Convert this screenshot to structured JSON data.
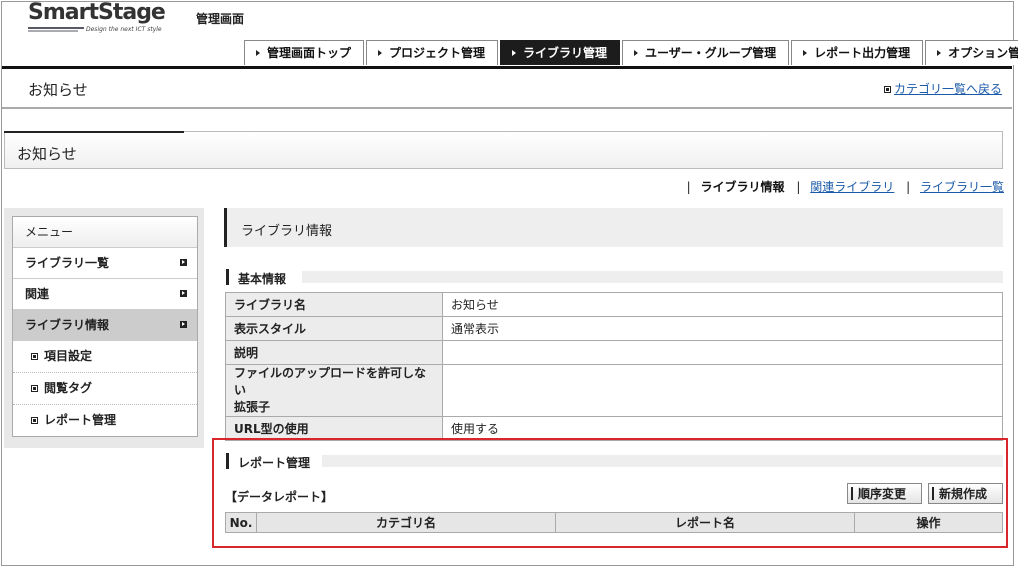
{
  "header": {
    "logo_text": "SmartStage",
    "logo_tagline": "Design the next ICT style",
    "admin_title": "管理画面"
  },
  "nav": {
    "items": [
      {
        "label": "管理画面トップ",
        "active": false
      },
      {
        "label": "プロジェクト管理",
        "active": false
      },
      {
        "label": "ライブラリ管理",
        "active": true
      },
      {
        "label": "ユーザー・グループ管理",
        "active": false
      },
      {
        "label": "レポート出力管理",
        "active": false
      },
      {
        "label": "オプション管理",
        "active": false
      }
    ]
  },
  "page": {
    "title": "お知らせ",
    "back_link": "カテゴリ一覧へ戻る",
    "section_title": "お知らせ"
  },
  "sublinks": {
    "current": "ライブラリ情報",
    "related": "関連ライブラリ",
    "list": "ライブラリ一覧"
  },
  "menu": {
    "heading": "メニュー",
    "items": [
      {
        "label": "ライブラリ一覧"
      },
      {
        "label": "関連"
      },
      {
        "label": "ライブラリ情報"
      }
    ],
    "subitems": [
      {
        "label": "項目設定"
      },
      {
        "label": "閲覧タグ"
      },
      {
        "label": "レポート管理"
      }
    ]
  },
  "content": {
    "title": "ライブラリ情報",
    "basic_info_heading": "基本情報",
    "rows": [
      {
        "key": "ライブラリ名",
        "value": "お知らせ"
      },
      {
        "key": "表示スタイル",
        "value": "通常表示"
      },
      {
        "key": "説明",
        "value": ""
      },
      {
        "key": "ファイルのアップロードを許可しない拡張子",
        "key_line1": "ファイルのアップロードを許可しない",
        "key_line2": "拡張子",
        "value": ""
      },
      {
        "key": "URL型の使用",
        "value": "使用する"
      }
    ]
  },
  "report": {
    "heading": "レポート管理",
    "data_report_label": "【データレポート】",
    "reorder_button": "順序変更",
    "new_button": "新規作成",
    "columns": [
      "No.",
      "カテゴリ名",
      "レポート名",
      "操作"
    ]
  },
  "colors": {
    "nav_active_bg": "#1c1c1c",
    "link": "#1a5aa8",
    "highlight_border": "#d9262c"
  }
}
